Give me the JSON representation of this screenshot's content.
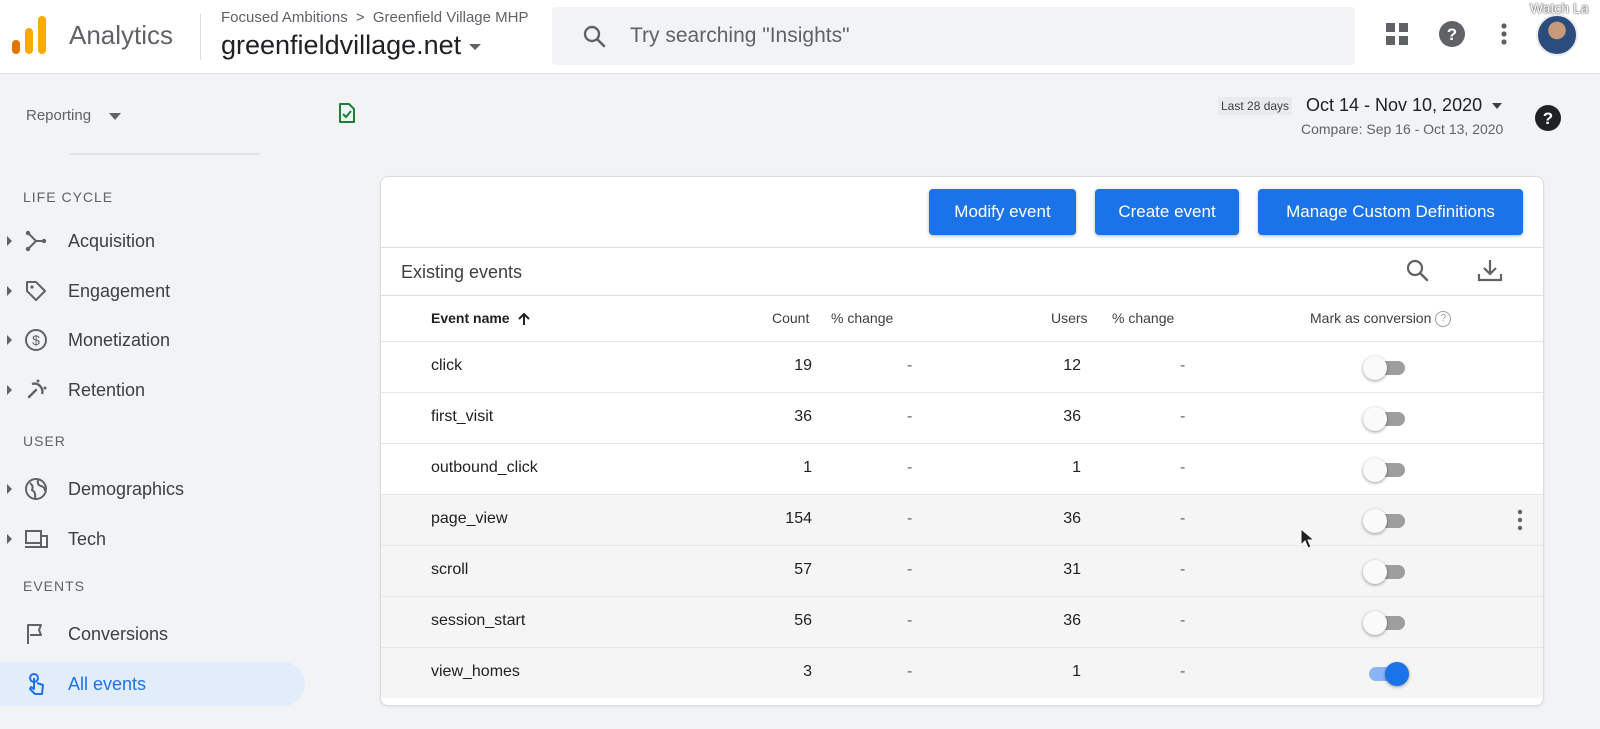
{
  "app": {
    "title": "Analytics"
  },
  "breadcrumb": {
    "account": "Focused Ambitions",
    "separator": ">",
    "property_path": "Greenfield Village MHP"
  },
  "property": {
    "name": "greenfieldvillage.net"
  },
  "search": {
    "placeholder": "Try searching \"Insights\""
  },
  "overlay": {
    "watch_text": "Watch La"
  },
  "sidebar": {
    "reporting_label": "Reporting",
    "sections": {
      "lifecycle": "LIFE CYCLE",
      "user": "USER",
      "events": "EVENTS"
    },
    "items": {
      "acquisition": "Acquisition",
      "engagement": "Engagement",
      "monetization": "Monetization",
      "retention": "Retention",
      "demographics": "Demographics",
      "tech": "Tech",
      "conversions": "Conversions",
      "all_events": "All events"
    }
  },
  "date": {
    "badge": "Last 28 days",
    "range": "Oct 14 - Nov 10, 2020",
    "compare": "Compare: Sep 16 - Oct 13, 2020"
  },
  "toolbar": {
    "modify_label": "Modify event",
    "create_label": "Create event",
    "manage_label": "Manage Custom Definitions"
  },
  "table": {
    "title": "Existing events",
    "headers": {
      "event_name": "Event name",
      "count": "Count",
      "count_change": "% change",
      "users": "Users",
      "users_change": "% change",
      "conversion": "Mark as conversion",
      "help": "?"
    },
    "rows": [
      {
        "name": "click",
        "count": "19",
        "count_change": "-",
        "users": "12",
        "users_change": "-",
        "conversion": false
      },
      {
        "name": "first_visit",
        "count": "36",
        "count_change": "-",
        "users": "36",
        "users_change": "-",
        "conversion": false
      },
      {
        "name": "outbound_click",
        "count": "1",
        "count_change": "-",
        "users": "1",
        "users_change": "-",
        "conversion": false
      },
      {
        "name": "page_view",
        "count": "154",
        "count_change": "-",
        "users": "36",
        "users_change": "-",
        "conversion": false
      },
      {
        "name": "scroll",
        "count": "57",
        "count_change": "-",
        "users": "31",
        "users_change": "-",
        "conversion": false
      },
      {
        "name": "session_start",
        "count": "56",
        "count_change": "-",
        "users": "36",
        "users_change": "-",
        "conversion": false
      },
      {
        "name": "view_homes",
        "count": "3",
        "count_change": "-",
        "users": "1",
        "users_change": "-",
        "conversion": true
      }
    ]
  },
  "colors": {
    "accent": "#1a73e8",
    "logo_orange": "#f9ab00",
    "logo_dark": "#e37400",
    "check_green": "#188038"
  },
  "icons": [
    "analytics-logo-icon",
    "search-icon",
    "apps-grid-icon",
    "help-icon",
    "more-vert-icon",
    "check-box-icon",
    "download-icon",
    "sort-arrow-up-icon",
    "acquisition-icon",
    "tag-icon",
    "dollar-icon",
    "retention-icon",
    "globe-icon",
    "devices-icon",
    "flag-icon",
    "touch-icon"
  ]
}
